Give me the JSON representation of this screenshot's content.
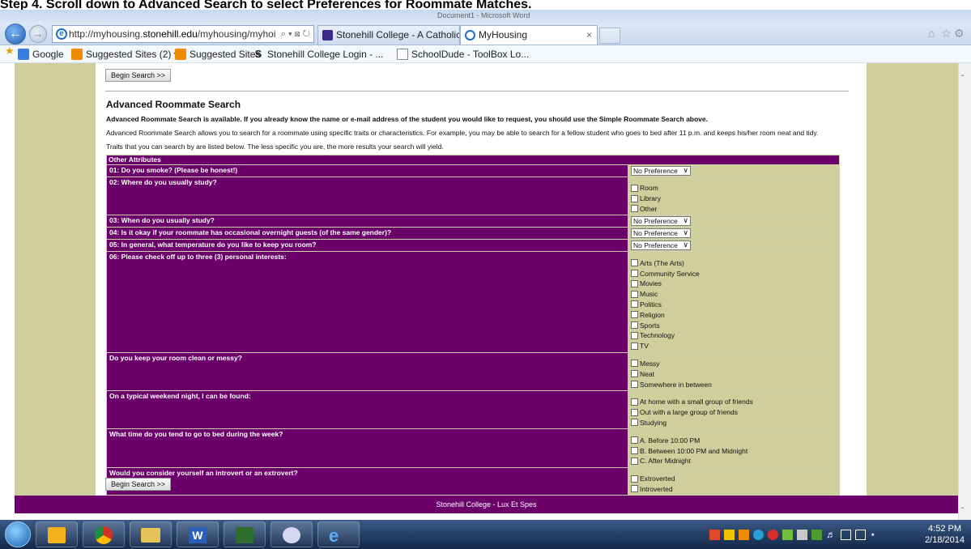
{
  "window": {
    "doc_caption": "Step 4. Scroll down to Advanced Search to select Preferences for Roommate Matches.",
    "title_center": "Document1 - Microsoft Word",
    "minimize": "–",
    "maximize": "▢",
    "close": "x"
  },
  "browser": {
    "url_host_prefix": "http://myhousing.",
    "url_host_bold": "stonehill.edu",
    "url_rest": "/myhousing/myhoi",
    "url_tools": "⌕ ▾ ⊠ ↻",
    "tabs": [
      {
        "label": "Stonehill College - A Catholic ...",
        "active": false
      },
      {
        "label": "MyHousing",
        "active": true,
        "close": "×"
      }
    ],
    "favorites": [
      {
        "label": "Google",
        "icon": "google-icon"
      },
      {
        "label": "Suggested Sites (2) ▾",
        "icon": "suggested-sites-icon"
      },
      {
        "label": "Suggested Sites",
        "icon": "suggested-sites-icon"
      },
      {
        "label": "Stonehill College Login - ...",
        "icon": "stonehill-icon"
      },
      {
        "label": "SchoolDude - ToolBox Lo...",
        "icon": "ie-page-icon"
      }
    ]
  },
  "page": {
    "begin_search_top": "Begin Search >>",
    "section_title": "Advanced Roommate Search",
    "intro_bold": "Advanced Roommate Search is available. If you already know the name or e-mail address of the student you would like to request, you should use the Simple Roommate Search above.",
    "intro_1": "Advanced Roommate Search allows you to search for a roommate using specific traits or characteristics. For example, you may be able to search for a fellow student who goes to bed after 11 p.m. and keeps his/her room neat and tidy.",
    "intro_2": "Traits that you can search by are listed below. The less specific you are, the more results your search will yield.",
    "table_header": "Other Attributes",
    "select_default": "No Preference",
    "questions": [
      {
        "q": "01: Do you smoke? (Please be honest!)",
        "type": "select"
      },
      {
        "q": "02: Where do you usually study?",
        "type": "checks",
        "options": [
          "Room",
          "Library",
          "Other"
        ]
      },
      {
        "q": "03: When do you usually study?",
        "type": "select"
      },
      {
        "q": "04: Is it okay if your roommate has occasional overnight guests (of the same gender)?",
        "type": "select"
      },
      {
        "q": "05: In general, what temperature do you like to keep you room?",
        "type": "select"
      },
      {
        "q": "06: Please check off up to three (3) personal interests:",
        "type": "checks",
        "options": [
          "Arts (The Arts)",
          "Community Service",
          "Movies",
          "Music",
          "Politics",
          "Religion",
          "Sports",
          "Technology",
          "TV"
        ]
      },
      {
        "q": "Do you keep your room clean or messy?",
        "type": "checks",
        "options": [
          "Messy",
          "Neat",
          "Somewhere in between"
        ]
      },
      {
        "q": "On a typical weekend night, I can be found:",
        "type": "checks",
        "options": [
          "At home with a small group of friends",
          "Out with a large group of friends",
          "Studying"
        ]
      },
      {
        "q": "What time do you tend to go to bed during the week?",
        "type": "checks",
        "options": [
          "A. Before 10:00 PM",
          "B. Between 10:00 PM and Midnight",
          "C. After Midnight"
        ]
      },
      {
        "q": "Would you consider yourself an introvert or an extrovert?",
        "type": "checks",
        "options": [
          "Extroverted",
          "Introverted"
        ]
      }
    ],
    "begin_search_bottom": "Begin Search >>",
    "footer": "Stonehill College - Lux Et Spes"
  },
  "taskbar": {
    "time": "4:52 PM",
    "date": "2/18/2014"
  }
}
